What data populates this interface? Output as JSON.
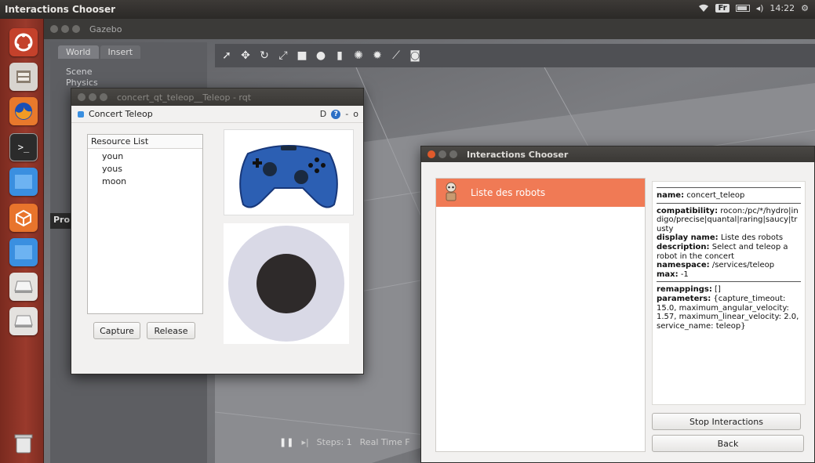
{
  "topbar": {
    "title": "Interactions Chooser",
    "keyboard": "Fr",
    "time": "14:22"
  },
  "gazebo": {
    "window_title": "Gazebo",
    "tabs": [
      {
        "label": "World"
      },
      {
        "label": "Insert"
      }
    ],
    "tree": [
      "Scene",
      "Physics"
    ],
    "side_label": "Pro",
    "bottom": {
      "steps": "Steps: 1",
      "realtime": "Real Time F"
    }
  },
  "rqt": {
    "window_title": "concert_qt_teleop__Teleop - rqt",
    "plugin_name": "Concert Teleop",
    "plugin_controls": "D",
    "resource_list": {
      "header": "Resource List",
      "items": [
        "youn",
        "yous",
        "moon"
      ]
    },
    "capture_label": "Capture",
    "release_label": "Release"
  },
  "chooser": {
    "window_title": "Interactions Chooser",
    "items": [
      {
        "label": "Liste des robots"
      }
    ],
    "details": {
      "name_key": "name:",
      "name": "concert_teleop",
      "compat_key": "compatibility:",
      "compat": "rocon:/pc/*/hydro|indigo/precise|quantal|raring|saucy|trusty",
      "display_key": "display name:",
      "display": "Liste des robots",
      "desc_key": "description:",
      "desc": "Select and teleop a robot in the concert",
      "ns_key": "namespace:",
      "ns": "/services/teleop",
      "max_key": "max:",
      "max": "-1",
      "remap_key": "remappings:",
      "remap": "[]",
      "params_key": "parameters:",
      "params": "{capture_timeout: 15.0, maximum_angular_velocity: 1.57, maximum_linear_velocity: 2.0, service_name: teleop}"
    },
    "stop_label": "Stop Interactions",
    "back_label": "Back"
  },
  "colors": {
    "launcher": "#9a3a2c",
    "selected_item": "#f07a55",
    "gamepad": "#2c5fb3"
  }
}
